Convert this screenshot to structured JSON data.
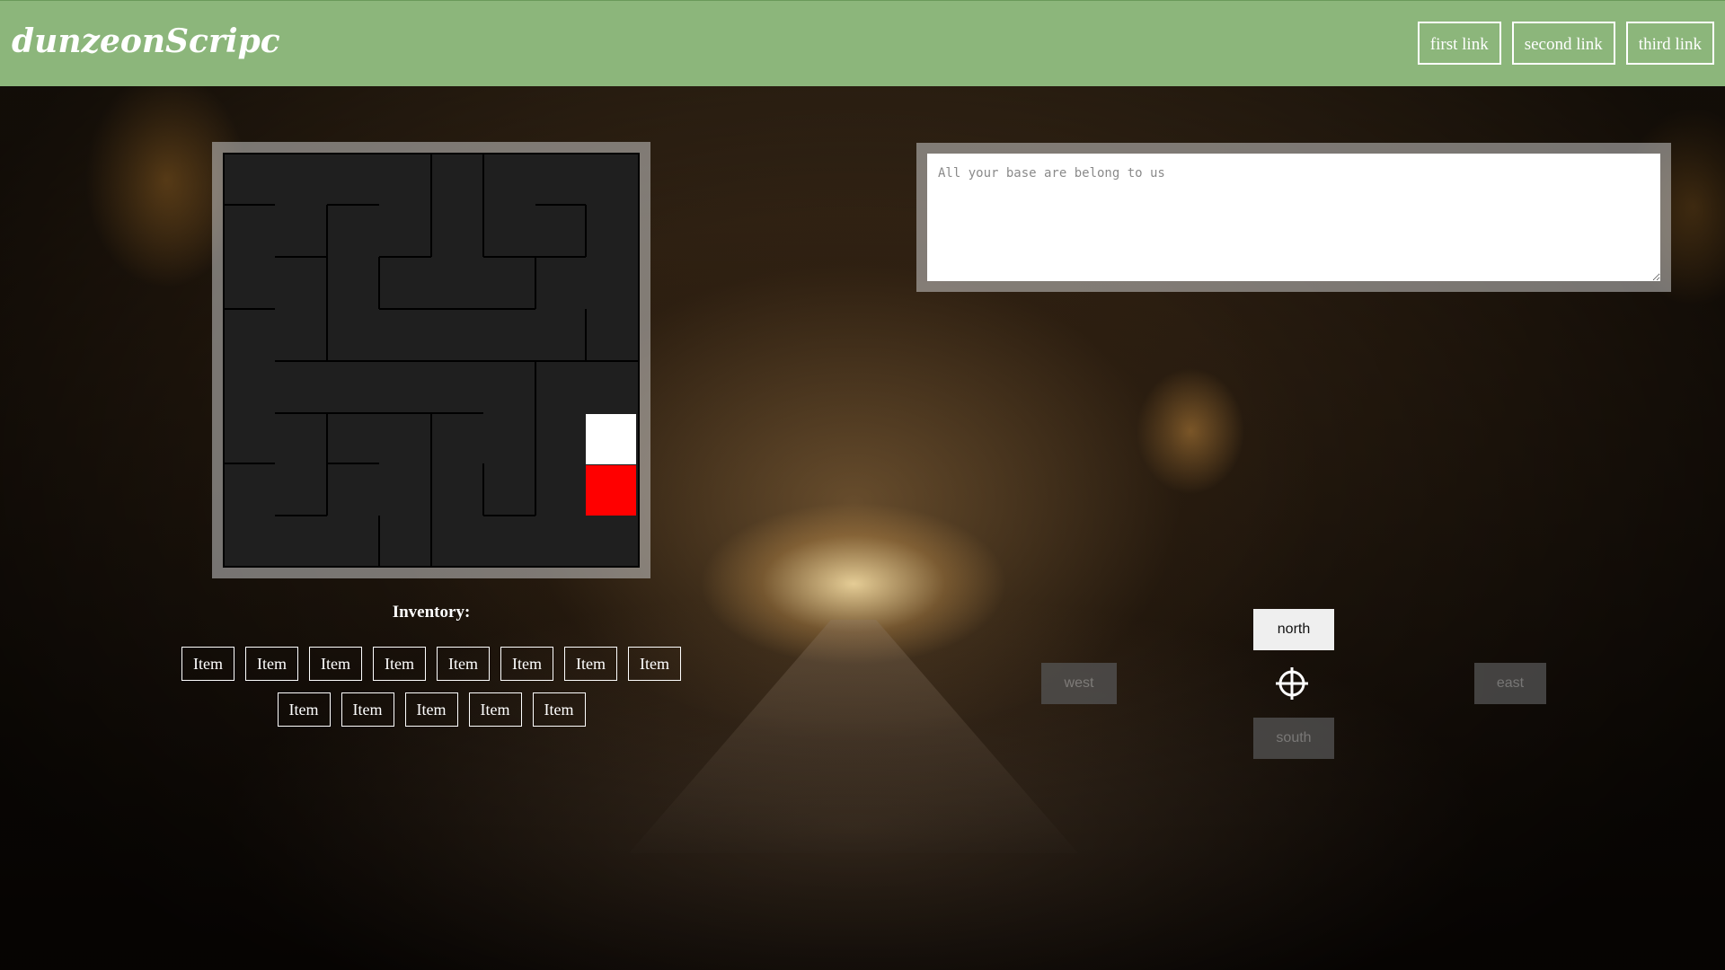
{
  "header": {
    "logo": "dunzeonScripc",
    "links": [
      "first link",
      "second link",
      "third link"
    ]
  },
  "console": {
    "placeholder": "All your base are belong to us"
  },
  "inventory": {
    "title": "Inventory:",
    "row1": [
      "Item",
      "Item",
      "Item",
      "Item",
      "Item",
      "Item",
      "Item",
      "Item"
    ],
    "row2": [
      "Item",
      "Item",
      "Item",
      "Item",
      "Item"
    ]
  },
  "controls": {
    "north": "north",
    "south": "south",
    "west": "west",
    "east": "east"
  },
  "colors": {
    "header": "#8cb67b",
    "player_tile": "#ffffff",
    "target_tile": "#ff0000"
  },
  "icons": [
    "crosshair-icon"
  ]
}
